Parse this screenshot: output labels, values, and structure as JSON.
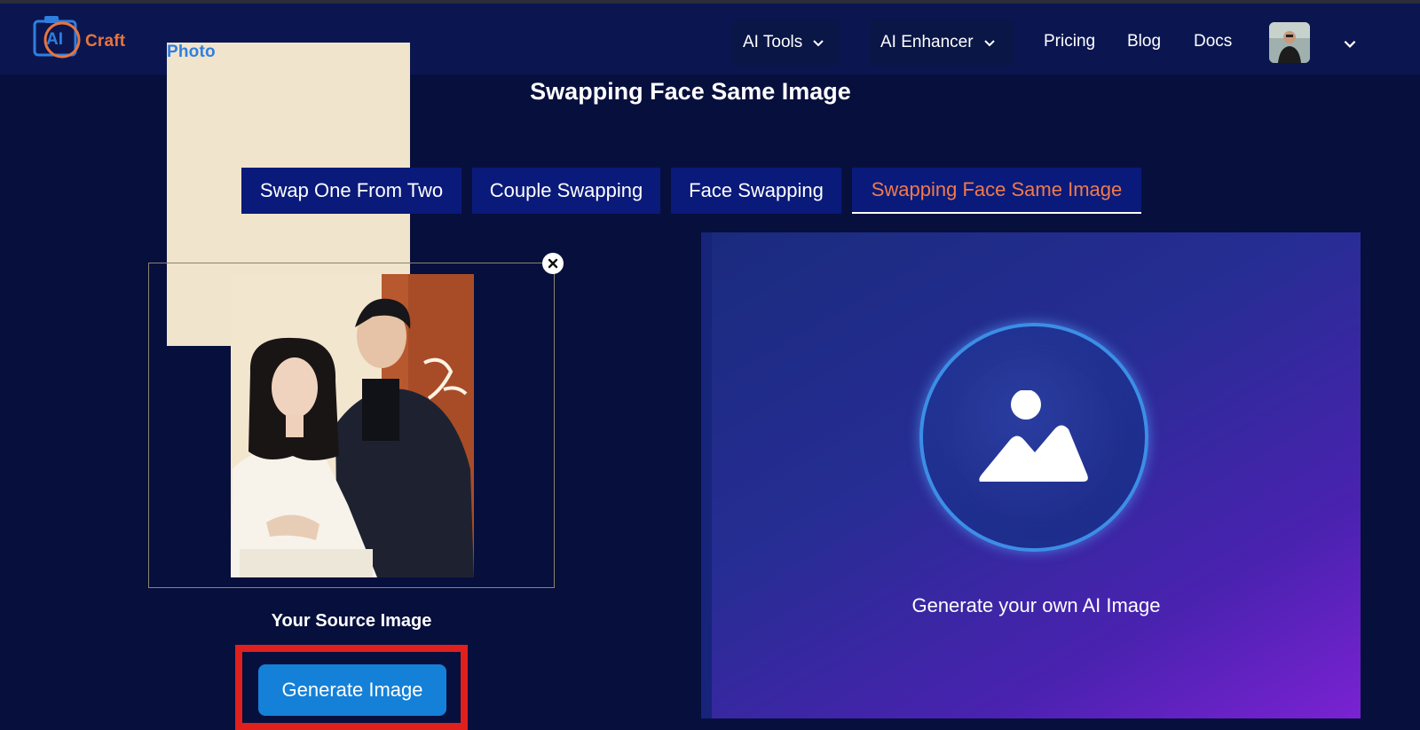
{
  "brand": {
    "ai": "AI",
    "photo": "Photo",
    "craft": "Craft"
  },
  "nav": {
    "ai_tools": "AI Tools",
    "ai_enhancer": "AI Enhancer",
    "pricing": "Pricing",
    "blog": "Blog",
    "docs": "Docs"
  },
  "page_title": "Swapping Face Same Image",
  "tabs": [
    {
      "label": "Swap One From Two",
      "active": false
    },
    {
      "label": "Couple Swapping",
      "active": false
    },
    {
      "label": "Face Swapping",
      "active": false
    },
    {
      "label": "Swapping Face Same Image",
      "active": true
    }
  ],
  "source": {
    "label": "Your Source Image",
    "close_icon": "close-icon"
  },
  "generate_button": "Generate Image",
  "output": {
    "placeholder_text": "Generate your own AI Image",
    "icon": "image-placeholder-icon"
  },
  "colors": {
    "background": "#070f3d",
    "header": "#0b1650",
    "tab": "#0a1a7a",
    "tab_active_text": "#f07a4c",
    "button": "#1580d8",
    "highlight": "#e0201d"
  }
}
